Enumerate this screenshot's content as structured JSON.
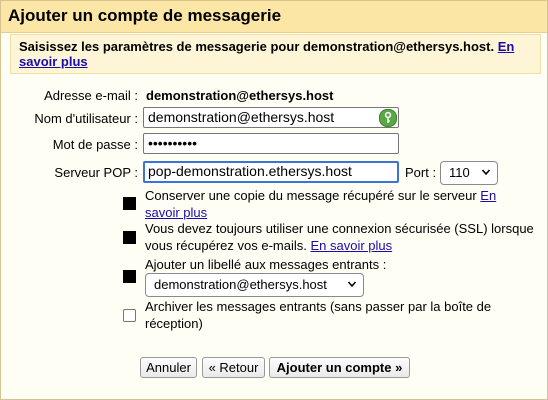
{
  "dialog": {
    "title": "Ajouter un compte de messagerie",
    "instructions": "Saisissez les paramètres de messagerie pour demonstration@ethersys.host.",
    "learn_more": "En savoir plus"
  },
  "form": {
    "email_label": "Adresse e-mail :",
    "email_value": "demonstration@ethersys.host",
    "username_label": "Nom d'utilisateur :",
    "username_value": "demonstration@ethersys.host",
    "password_label": "Mot de passe :",
    "password_value": "••••••••••",
    "pop_label": "Serveur POP :",
    "pop_value": "pop-demonstration.ethersys.host",
    "port_label": "Port :",
    "port_value": "110"
  },
  "options": {
    "keep_copy": {
      "text": "Conserver une copie du message récupéré sur le serveur",
      "link": "En savoir plus",
      "checked": true
    },
    "ssl": {
      "text": "Vous devez toujours utiliser une connexion sécurisée (SSL) lorsque vous récupérez vos e-mails.",
      "link": "En savoir plus",
      "checked": true
    },
    "label": {
      "text": "Ajouter un libellé aux messages entrants :",
      "select_value": "demonstration@ethersys.host",
      "checked": true
    },
    "archive": {
      "text": "Archiver les messages entrants (sans passer par la boîte de réception)",
      "checked": false
    }
  },
  "buttons": {
    "cancel": "Annuler",
    "back": "« Retour",
    "add": "Ajouter un compte »"
  },
  "icons": {
    "username_field_icon": "password-manager-key-icon",
    "select_chevron": "chevron-down-icon"
  },
  "colors": {
    "titlebar": "#fbe6a6",
    "panel": "#fdf5d6",
    "link": "#1a0dab",
    "focus": "#3b73d6",
    "key_icon": "#5aa844"
  }
}
